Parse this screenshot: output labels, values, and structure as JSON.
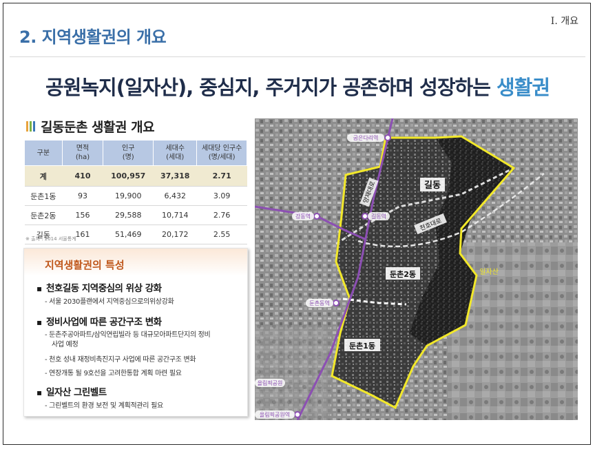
{
  "header": {
    "section_title": "2. 지역생활권의 개요",
    "section_number": "Ⅰ. 개요"
  },
  "headline": {
    "main": "공원녹지(일자산), 중심지, 주거지가  공존하며 성장하는 ",
    "highlight": "생활권"
  },
  "overview": {
    "title": "길동둔촌 생활권 개요",
    "icon": "bar-chart-icon",
    "table": {
      "headers": [
        {
          "line1": "구분",
          "line2": ""
        },
        {
          "line1": "면적",
          "line2": "(ha)"
        },
        {
          "line1": "인구",
          "line2": "(명)"
        },
        {
          "line1": "세대수",
          "line2": "(세대)"
        },
        {
          "line1": "세대당 인구수",
          "line2": "(명/세대)"
        }
      ],
      "rows": [
        [
          "계",
          "410",
          "100,957",
          "37,318",
          "2.71"
        ],
        [
          "둔촌1동",
          "93",
          "19,900",
          "6,432",
          "3.09"
        ],
        [
          "둔촌2동",
          "156",
          "29,588",
          "10,714",
          "2.76"
        ],
        [
          "길동",
          "161",
          "51,469",
          "20,172",
          "2.55"
        ]
      ]
    },
    "source": "※ 출처 : 2014 서울통계"
  },
  "features": {
    "title": "지역생활권의 특성",
    "items": [
      {
        "bullet": "천호길동 지역중심의 위상 강화",
        "subs": [
          "- 서울 2030플랜에서 지역중심으로의위상강화"
        ]
      },
      {
        "bullet": "정비사업에 따른 공간구조 변화",
        "subs": [
          "- 둔촌주공아파트/삼익연립빌라 등 대규모아파트단지의 정비",
          "  사업 예정",
          "- 천호 성내 재정비촉진지구 사업에 따른 공간구조 변화",
          "- 연장개통 될 9호선을 고려한통합 계획 마련 필요"
        ]
      },
      {
        "bullet": "일자산 그린벨트",
        "subs": [
          "- 그린벨트의 환경 보전 및 계획적관리 필요"
        ]
      }
    ]
  },
  "map": {
    "labels": {
      "gildong": "길동",
      "dunchon2": "둔촌2동",
      "dunchon1": "둔촌1동",
      "iljasan": "일자산",
      "cheonho_road": "천호대로",
      "yangjae_road": "양재대로"
    },
    "stations": {
      "gubeundari": "굽은다리역",
      "gangdong": "강동역",
      "gildong_stn": "길동역",
      "dunchondong": "둔촌동역",
      "olympic_park": "올림픽공원",
      "olympic_park_stn": "올림픽공원역"
    },
    "colors": {
      "boundary": "#f2e82a",
      "subway": "#8c4fb3",
      "road": "#e6e6e6"
    }
  }
}
